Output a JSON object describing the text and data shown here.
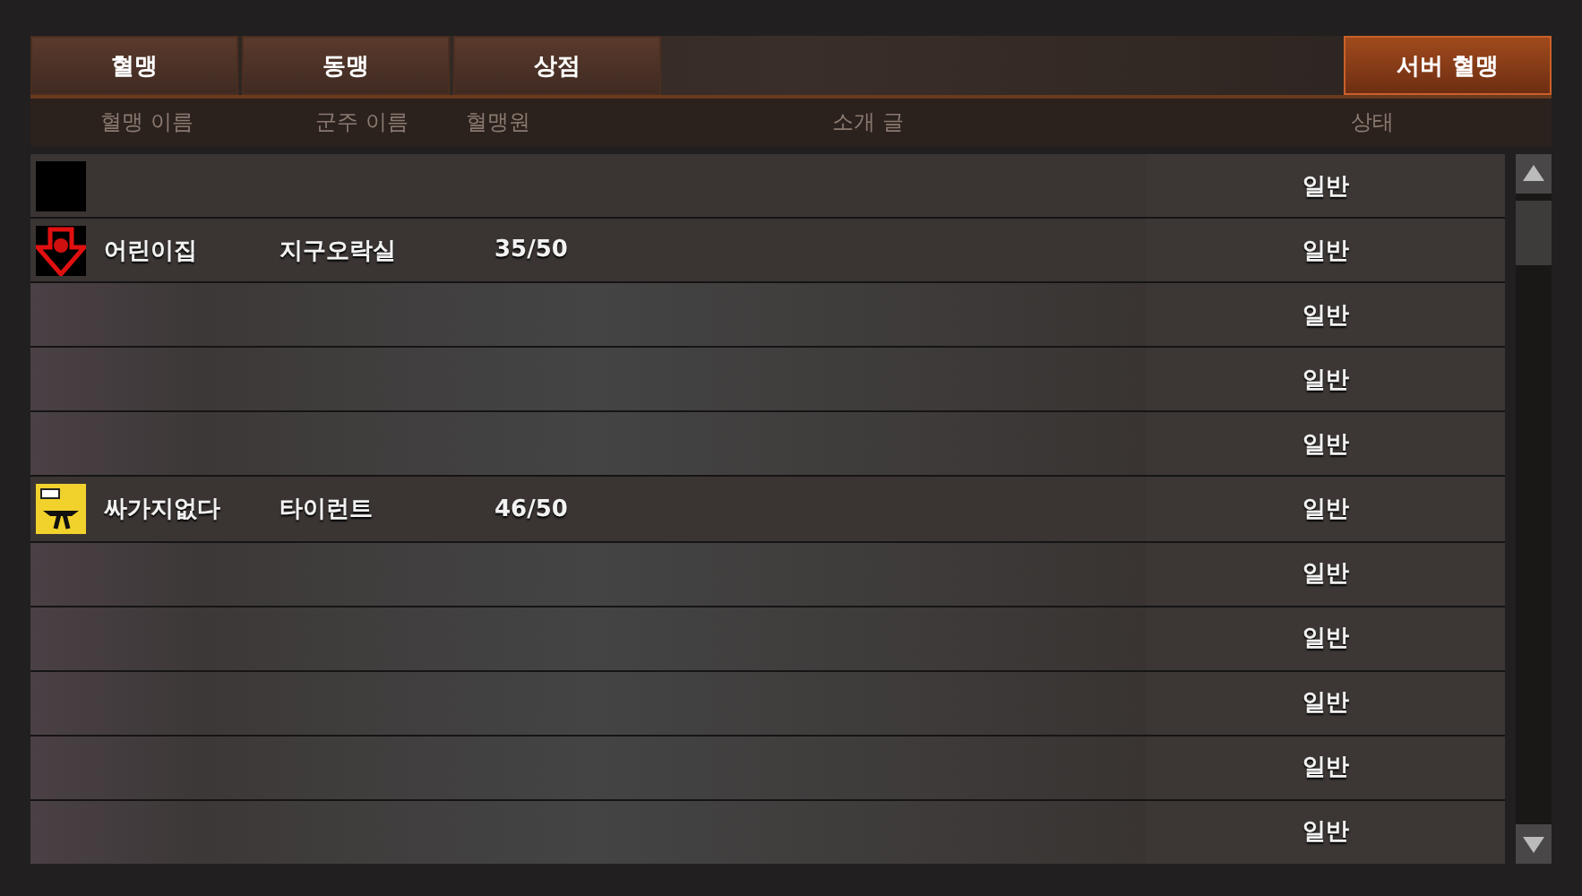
{
  "tabs": [
    {
      "label": "혈맹",
      "selected": false
    },
    {
      "label": "동맹",
      "selected": false
    },
    {
      "label": "상점",
      "selected": false
    },
    {
      "label": "서버 혈맹",
      "selected": true
    }
  ],
  "table": {
    "columns": [
      "혈맹 이름",
      "군주 이름",
      "혈맹원",
      "소개 글",
      "상태"
    ],
    "rows": [
      {
        "kind": "emblem-only",
        "emblem": {
          "kind": "blank"
        },
        "status": "일반"
      },
      {
        "kind": "clan",
        "emblem": {
          "kind": "arrow"
        },
        "name": "어린이집",
        "leader": "지구오락실",
        "members": "35/50",
        "status": "일반"
      },
      {
        "kind": "blurred",
        "status": "일반"
      },
      {
        "kind": "blurred",
        "status": "일반"
      },
      {
        "kind": "blurred",
        "status": "일반"
      },
      {
        "kind": "clan",
        "emblem": {
          "kind": "yellow"
        },
        "name": "싸가지없다",
        "leader": "타이런트",
        "members": "46/50",
        "status": "일반"
      },
      {
        "kind": "blurred",
        "status": "일반"
      },
      {
        "kind": "blurred",
        "status": "일반"
      },
      {
        "kind": "blurred",
        "status": "일반"
      },
      {
        "kind": "blurred",
        "status": "일반"
      },
      {
        "kind": "blurred",
        "status": "일반"
      }
    ]
  }
}
